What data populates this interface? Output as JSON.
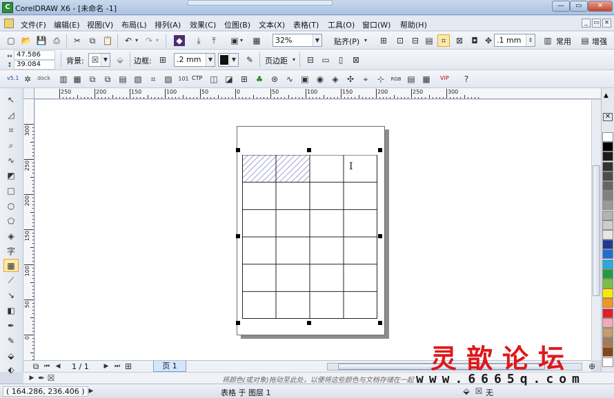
{
  "window": {
    "title": "CorelDRAW X6 - [未命名 -1]",
    "logo": "coreldraw-logo"
  },
  "menu": [
    "文件(F)",
    "编辑(E)",
    "视图(V)",
    "布局(L)",
    "排列(A)",
    "效果(C)",
    "位图(B)",
    "文本(X)",
    "表格(T)",
    "工具(O)",
    "窗口(W)",
    "帮助(H)"
  ],
  "standard_toolbar": {
    "zoom": "32%",
    "snap_label": "贴齐(P)",
    "nudge": ".1 mm",
    "launcher_label": "常用",
    "enhance_label": "增强"
  },
  "property_bar": {
    "width": "47.586 mm",
    "height": "39.084 mm",
    "background_label": "背景:",
    "border_label": "边框:",
    "border_width": ".2 mm",
    "page_margin_label": "页边距"
  },
  "plugin_toolbar": {
    "version_label": "v5.1",
    "dock_label": "dock",
    "ctp_label": "CTP",
    "vip_label": "VIP"
  },
  "ruler": {
    "horizontal_labels": [
      "250",
      "200",
      "150",
      "100",
      "50",
      "0",
      "50",
      "100",
      "150",
      "200",
      "250",
      "300"
    ],
    "vertical_labels": [
      "300",
      "250",
      "200",
      "150",
      "100",
      "50",
      "0"
    ],
    "unit": "毫米"
  },
  "table": {
    "rows": 6,
    "cols": 4,
    "hatched_cells": [
      [
        0,
        0
      ],
      [
        0,
        1
      ]
    ]
  },
  "pages": {
    "counter": "1 / 1",
    "tab": "页 1"
  },
  "hint": "将颜色(或对象)拖动至此处，以便将这些颜色与文档存储在一起",
  "status": {
    "coords": "( 164.286, 236.406 )",
    "object": "表格 于 图层 1",
    "fill_label": "无"
  },
  "palette": [
    "#ffffff",
    "#000000",
    "#1a1a1a",
    "#333333",
    "#4d4d4d",
    "#666666",
    "#808080",
    "#999999",
    "#b3b3b3",
    "#cccccc",
    "#e6e6e6",
    "#1f3a93",
    "#1d6fd1",
    "#29a8e0",
    "#1f9d3a",
    "#7bc043",
    "#ffe600",
    "#f7941d",
    "#e31e24",
    "#f3a9b8",
    "#c69c6d",
    "#a67c52",
    "#8b4513",
    "#ffffff"
  ],
  "watermark": {
    "text": "灵歆论坛",
    "url": "www.6665q.com"
  }
}
